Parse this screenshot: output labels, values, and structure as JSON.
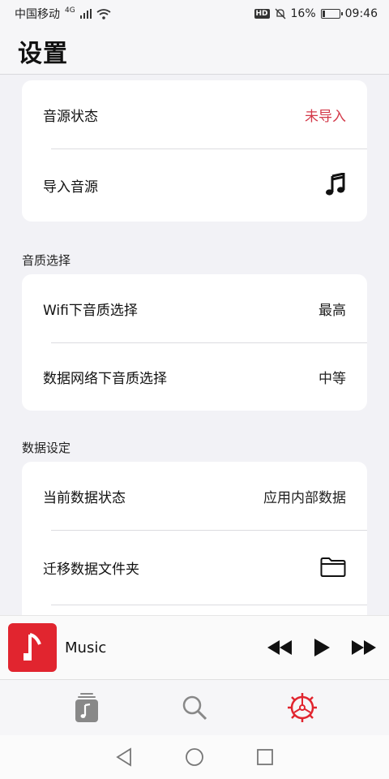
{
  "status": {
    "carrier": "中国移动",
    "network": "4G",
    "battery_pct": "16%",
    "battery_level": 0.16,
    "time": "09:46",
    "hd": "HD"
  },
  "header": {
    "title": "设置"
  },
  "card_source": {
    "rows": [
      {
        "label": "音源状态",
        "value": "未导入"
      },
      {
        "label": "导入音源",
        "icon": "music-note-icon"
      }
    ]
  },
  "quality": {
    "section_title": "音质选择",
    "rows": [
      {
        "label": "Wifi下音质选择",
        "value": "最高"
      },
      {
        "label": "数据网络下音质选择",
        "value": "中等"
      }
    ]
  },
  "data_settings": {
    "section_title": "数据设定",
    "rows": [
      {
        "label": "当前数据状态",
        "value": "应用内部数据"
      },
      {
        "label": "迁移数据文件夹",
        "icon": "folder-icon"
      }
    ]
  },
  "player": {
    "title": "Music"
  },
  "colors": {
    "accent": "#e1252f",
    "alert": "#d33a4a",
    "background": "#f2f2f6"
  },
  "tabs": [
    {
      "icon": "library-icon"
    },
    {
      "icon": "search-icon"
    },
    {
      "icon": "settings-gear-icon",
      "active": true
    }
  ]
}
